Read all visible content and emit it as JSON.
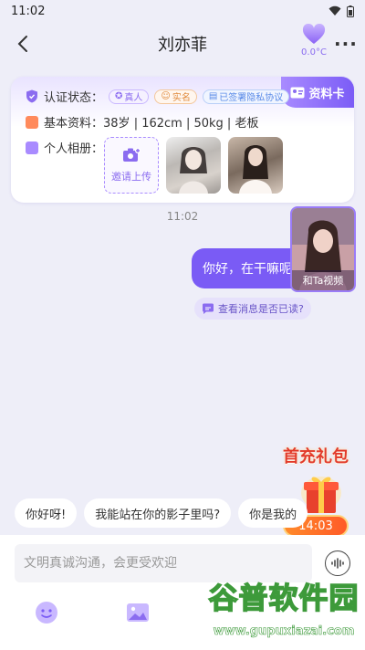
{
  "status": {
    "time": "11:02"
  },
  "header": {
    "title": "刘亦菲",
    "intimacy": "0.0°C"
  },
  "profile_card": {
    "badge": "资料卡",
    "verify_label": "认证状态：",
    "tags": [
      "真人",
      "实名",
      "已签署隐私协议"
    ],
    "basic_label": "基本资料：",
    "basic_value": "38岁 | 162cm | 50kg | 老板",
    "album_label": "个人相册：",
    "upload_label": "邀请上传"
  },
  "chat": {
    "timestamp": "11:02",
    "message": "你好，在干嘛呢",
    "read_check": "查看消息是否已读?",
    "video_label": "和Ta视频"
  },
  "promo": {
    "title": "首充礼包",
    "timer": "14:03"
  },
  "quick_replies": [
    "你好呀!",
    "我能站在你的影子里吗?",
    "你是我的"
  ],
  "input": {
    "placeholder": "文明真诚沟通，会更受欢迎"
  },
  "watermark": {
    "big": "谷普软件园",
    "small": "www.gupuxiazai.com"
  },
  "colors": {
    "accent": "#7a5bf5",
    "background": "#eeeef8",
    "promo_red": "#e23b2a"
  }
}
